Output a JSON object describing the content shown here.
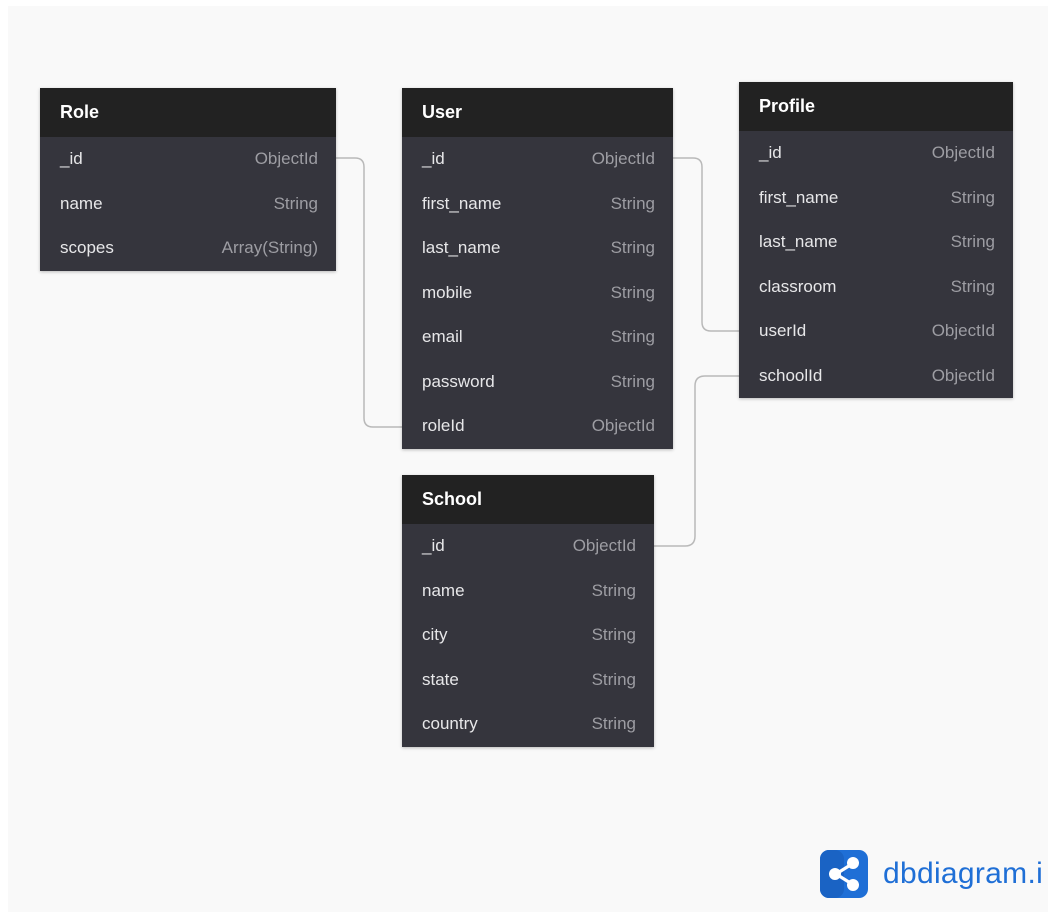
{
  "tables": {
    "role": {
      "name": "Role",
      "fields": [
        {
          "name": "_id",
          "type": "ObjectId"
        },
        {
          "name": "name",
          "type": "String"
        },
        {
          "name": "scopes",
          "type": "Array(String)"
        }
      ]
    },
    "user": {
      "name": "User",
      "fields": [
        {
          "name": "_id",
          "type": "ObjectId"
        },
        {
          "name": "first_name",
          "type": "String"
        },
        {
          "name": "last_name",
          "type": "String"
        },
        {
          "name": "mobile",
          "type": "String"
        },
        {
          "name": "email",
          "type": "String"
        },
        {
          "name": "password",
          "type": "String"
        },
        {
          "name": "roleId",
          "type": "ObjectId"
        }
      ]
    },
    "profile": {
      "name": "Profile",
      "fields": [
        {
          "name": "_id",
          "type": "ObjectId"
        },
        {
          "name": "first_name",
          "type": "String"
        },
        {
          "name": "last_name",
          "type": "String"
        },
        {
          "name": "classroom",
          "type": "String"
        },
        {
          "name": "userId",
          "type": "ObjectId"
        },
        {
          "name": "schoolId",
          "type": "ObjectId"
        }
      ]
    },
    "school": {
      "name": "School",
      "fields": [
        {
          "name": "_id",
          "type": "ObjectId"
        },
        {
          "name": "name",
          "type": "String"
        },
        {
          "name": "city",
          "type": "String"
        },
        {
          "name": "state",
          "type": "String"
        },
        {
          "name": "country",
          "type": "String"
        }
      ]
    }
  },
  "relations": [
    {
      "from": "Role._id",
      "to": "User.roleId"
    },
    {
      "from": "User._id",
      "to": "Profile.userId"
    },
    {
      "from": "School._id",
      "to": "Profile.schoolId"
    }
  ],
  "brand": {
    "text": "dbdiagram.i",
    "icon": "share-nodes-icon",
    "color": "#1f6fd6"
  },
  "colors": {
    "header": "#222222",
    "body": "#35353d",
    "canvas": "#f9f9f9",
    "line": "#b9b9b9"
  }
}
